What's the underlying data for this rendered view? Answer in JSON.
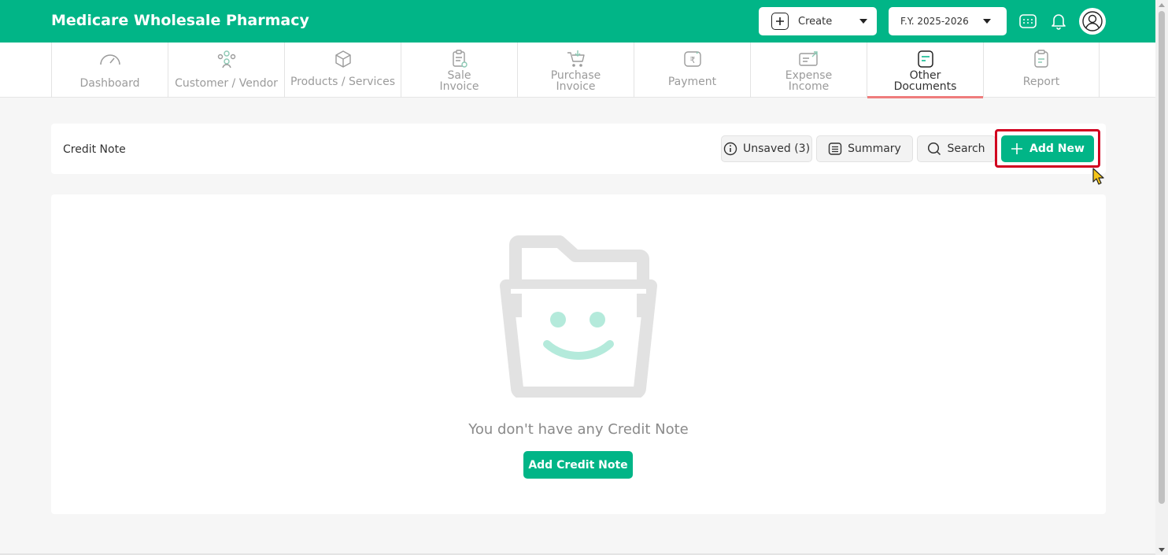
{
  "app": {
    "title": "Medicare Wholesale Pharmacy"
  },
  "header": {
    "create_label": "Create",
    "fy_label": "F.Y. 2025-2026"
  },
  "nav": {
    "items": [
      {
        "label": "Dashboard"
      },
      {
        "label": "Customer / Vendor"
      },
      {
        "label": "Products / Services"
      },
      {
        "line1": "Sale",
        "line2": "Invoice"
      },
      {
        "line1": "Purchase",
        "line2": "Invoice"
      },
      {
        "label": "Payment"
      },
      {
        "line1": "Expense",
        "line2": "Income"
      },
      {
        "line1": "Other",
        "line2": "Documents"
      },
      {
        "label": "Report"
      }
    ]
  },
  "toolbar": {
    "title": "Credit Note",
    "unsaved_label": "Unsaved (3)",
    "summary_label": "Summary",
    "search_label": "Search",
    "add_new_label": "Add New"
  },
  "empty": {
    "message": "You don't have any Credit Note",
    "button_label": "Add Credit Note"
  },
  "colors": {
    "brand": "#01b587",
    "active_tab_underline": "#ef7d7d",
    "highlight": "#d1001f"
  }
}
